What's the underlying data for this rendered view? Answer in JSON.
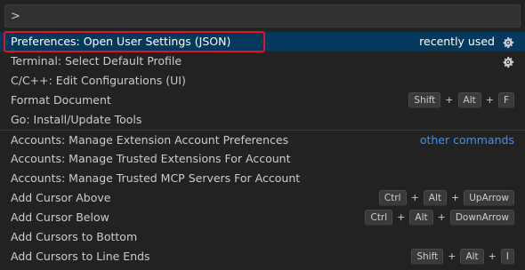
{
  "input": {
    "value": ">",
    "placeholder": ""
  },
  "rows": [
    {
      "label": "Preferences: Open User Settings (JSON)",
      "detail": "recently used",
      "gear": true,
      "selected": true
    },
    {
      "label": "Terminal: Select Default Profile",
      "gear": true
    },
    {
      "label": "C/C++: Edit Configurations (UI)"
    },
    {
      "label": "Format Document",
      "keys": [
        "Shift",
        "Alt",
        "F"
      ]
    },
    {
      "label": "Go: Install/Update Tools"
    },
    {
      "label": "Accounts: Manage Extension Account Preferences",
      "link": "other commands",
      "separated": true
    },
    {
      "label": "Accounts: Manage Trusted Extensions For Account"
    },
    {
      "label": "Accounts: Manage Trusted MCP Servers For Account"
    },
    {
      "label": "Add Cursor Above",
      "keys": [
        "Ctrl",
        "Alt",
        "UpArrow"
      ]
    },
    {
      "label": "Add Cursor Below",
      "keys": [
        "Ctrl",
        "Alt",
        "DownArrow"
      ]
    },
    {
      "label": "Add Cursors to Bottom"
    },
    {
      "label": "Add Cursors to Line Ends",
      "keys": [
        "Shift",
        "Alt",
        "I"
      ]
    }
  ],
  "icons": {
    "gear": "gear-icon"
  },
  "colors": {
    "selected_bg": "#04395e",
    "link": "#3794ff",
    "highlight_border": "#e81123"
  }
}
